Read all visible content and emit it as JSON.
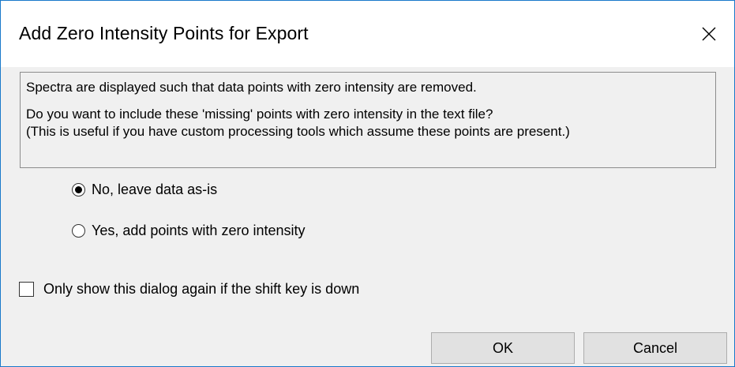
{
  "dialog": {
    "title": "Add Zero Intensity Points for Export",
    "close_icon": "close-icon"
  },
  "info": {
    "line1": "Spectra are displayed such that data points with zero intensity are removed.",
    "line2": "Do you want to include these 'missing' points with zero intensity in the text file?",
    "line3": "(This is useful if you have custom processing tools which assume these points are present.)"
  },
  "options": {
    "no_label": "No, leave data as-is",
    "no_selected": true,
    "yes_label": "Yes, add points with zero intensity",
    "yes_selected": false
  },
  "checkbox": {
    "label": "Only show this dialog again if the shift key is down",
    "checked": false
  },
  "buttons": {
    "ok_label": "OK",
    "cancel_label": "Cancel"
  },
  "colors": {
    "window_border": "#1979ca",
    "dialog_bg": "#f0f0f0",
    "button_bg": "#e1e1e1",
    "button_border": "#adadad"
  }
}
